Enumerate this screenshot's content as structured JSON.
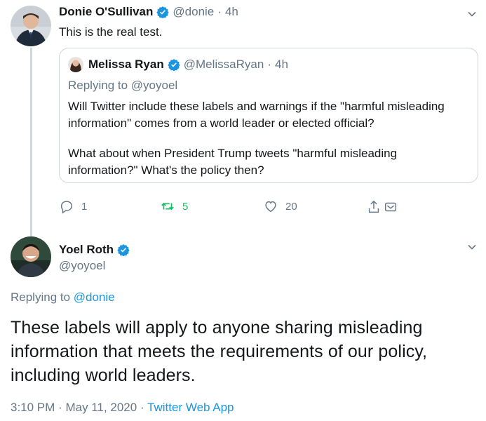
{
  "tweet1": {
    "name": "Donie O'Sullivan",
    "handle": "@donie",
    "time": "4h",
    "text": "This is the real test."
  },
  "quoted": {
    "name": "Melissa Ryan",
    "handle": "@MelissaRyan",
    "time": "4h",
    "replying_prefix": "Replying to",
    "replying_handle": "@yoyoel",
    "para1": "Will Twitter include these labels and warnings if the \"harmful misleading information\" comes from a world leader or elected official?",
    "para2": "What about when President Trump tweets \"harmful misleading information?\" What's the policy then?"
  },
  "actions": {
    "reply_count": "1",
    "retweet_count": "5",
    "like_count": "20"
  },
  "tweet2": {
    "name": "Yoel Roth",
    "handle": "@yoyoel",
    "replying_prefix": "Replying to",
    "replying_handle": "@donie",
    "text": "These labels will apply to anyone sharing misleading information that meets the requirements of our policy, including world leaders.",
    "time": "3:10 PM",
    "date": "May 11, 2020",
    "source": "Twitter Web App"
  },
  "colors": {
    "accent": "#1b95e0",
    "retweet_green": "#17bf63",
    "muted": "#657786"
  },
  "icons": [
    "verified-badge-icon",
    "chevron-down-icon",
    "reply-icon",
    "retweet-icon",
    "like-icon",
    "share-icon",
    "dm-icon"
  ]
}
